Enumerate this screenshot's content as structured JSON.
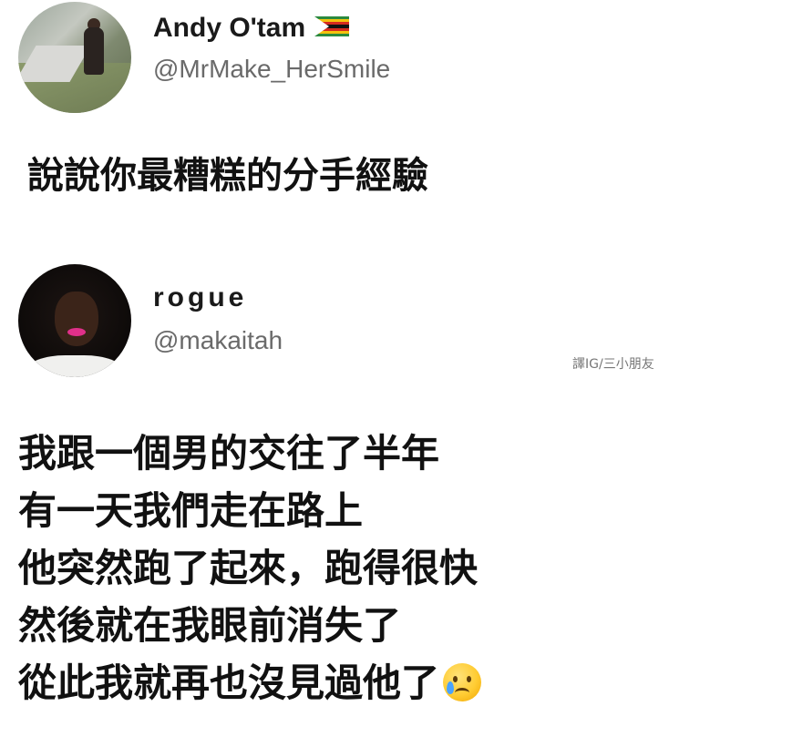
{
  "tweet1": {
    "name": "Andy O'tam",
    "flag_icon": "zimbabwe-flag-icon",
    "handle": "@MrMake_HerSmile",
    "text": "說說你最糟糕的分手經驗"
  },
  "tweet2": {
    "name": "rogue",
    "handle": "@makaitah",
    "watermark": "譯IG/三小朋友",
    "lines": [
      "我跟一個男的交往了半年",
      "有一天我們走在路上",
      "他突然跑了起來，跑得很快",
      "然後就在我眼前消失了",
      "從此我就再也沒見過他了"
    ],
    "emoji_icon": "crying-face-icon"
  },
  "colors": {
    "text": "#111111",
    "handle": "#6a6a6a",
    "background": "#ffffff"
  }
}
